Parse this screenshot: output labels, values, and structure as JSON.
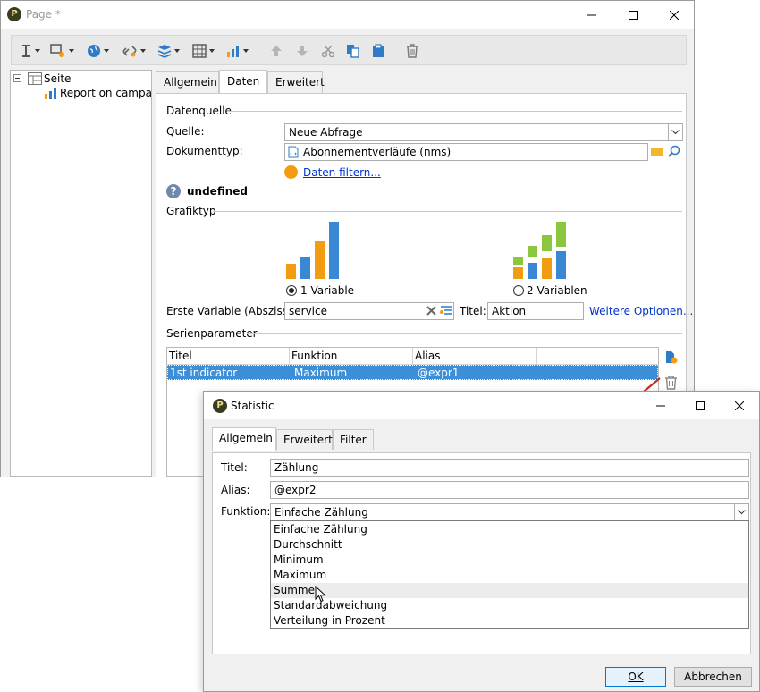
{
  "main_window": {
    "title": "Page *",
    "tree": {
      "root_label": "Seite",
      "child_label": "Report on campan..."
    },
    "tabs": [
      "Allgemein",
      "Daten",
      "Erweitert"
    ],
    "datenquelle": {
      "section_title": "Datenquelle",
      "quelle_label": "Quelle:",
      "quelle_value": "Neue Abfrage",
      "dokumenttyp_label": "Dokumenttyp:",
      "dokumenttyp_value": "Abonnementverläufe (nms)",
      "filter_link": "Daten filtern...",
      "undefined_label": "undefined"
    },
    "grafiktyp": {
      "section_title": "Grafiktyp",
      "option1": "1 Variable",
      "option2": "2 Variablen",
      "x_label": "Erste Variable (Abszisse):",
      "x_value": "service",
      "titel_label": "Titel:",
      "titel_value": "Aktion",
      "more_link": "Weitere Optionen..."
    },
    "serienparameter": {
      "section_title": "Serienparameter",
      "columns": [
        "Titel",
        "Funktion",
        "Alias"
      ],
      "rows": [
        {
          "titel": "1st indicator",
          "funktion": "Maximum",
          "alias": "@expr1"
        }
      ]
    }
  },
  "dialog": {
    "title": "Statistic",
    "tabs": [
      "Allgemein",
      "Erweitert",
      "Filter"
    ],
    "titel_label": "Titel:",
    "titel_value": "Zählung",
    "alias_label": "Alias:",
    "alias_value": "@expr2",
    "funktion_label": "Funktion:",
    "funktion_value": "Einfache Zählung",
    "options": [
      "Einfache Zählung",
      "Durchschnitt",
      "Minimum",
      "Maximum",
      "Summe",
      "Standardabweichung",
      "Verteilung in Prozent"
    ],
    "hovered_option": "Summe",
    "ok_label": "OK",
    "cancel_label": "Abbrechen"
  },
  "colors": {
    "selection": "#3b8fd9",
    "link": "#0033cc",
    "chart_orange": "#f39c12",
    "chart_blue": "#3a87d4",
    "chart_green": "#8cc63f",
    "annotation_arrow": "#c0302b"
  }
}
